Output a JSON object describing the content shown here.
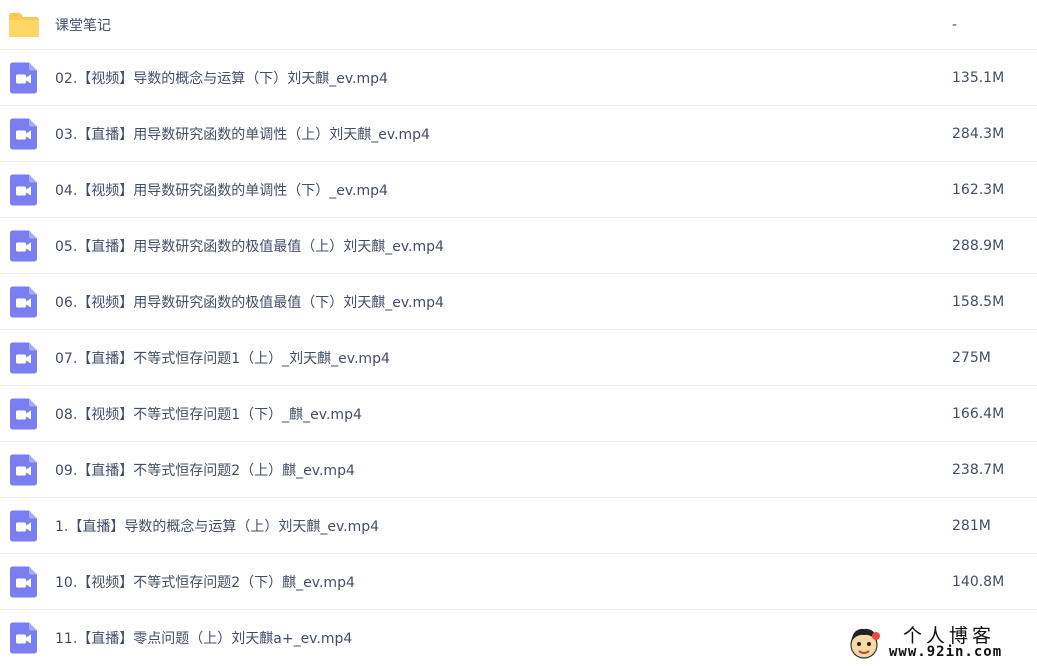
{
  "files": [
    {
      "name": "课堂笔记",
      "size": "-",
      "type": "folder",
      "icon": "folder-icon"
    },
    {
      "name": "02.【视频】导数的概念与运算（下）刘天麒_ev.mp4",
      "size": "135.1M",
      "type": "video",
      "icon": "video-file-icon"
    },
    {
      "name": "03.【直播】用导数研究函数的单调性（上）刘天麒_ev.mp4",
      "size": "284.3M",
      "type": "video",
      "icon": "video-file-icon"
    },
    {
      "name": "04.【视频】用导数研究函数的单调性（下）_ev.mp4",
      "size": "162.3M",
      "type": "video",
      "icon": "video-file-icon"
    },
    {
      "name": "05.【直播】用导数研究函数的极值最值（上）刘天麒_ev.mp4",
      "size": "288.9M",
      "type": "video",
      "icon": "video-file-icon"
    },
    {
      "name": "06.【视频】用导数研究函数的极值最值（下）刘天麒_ev.mp4",
      "size": "158.5M",
      "type": "video",
      "icon": "video-file-icon"
    },
    {
      "name": "07.【直播】不等式恒存问题1（上）_刘天麒_ev.mp4",
      "size": "275M",
      "type": "video",
      "icon": "video-file-icon"
    },
    {
      "name": "08.【视频】不等式恒存问题1（下）_麒_ev.mp4",
      "size": "166.4M",
      "type": "video",
      "icon": "video-file-icon"
    },
    {
      "name": "09.【直播】不等式恒存问题2（上）麒_ev.mp4",
      "size": "238.7M",
      "type": "video",
      "icon": "video-file-icon"
    },
    {
      "name": "1.【直播】导数的概念与运算（上）刘天麒_ev.mp4",
      "size": "281M",
      "type": "video",
      "icon": "video-file-icon"
    },
    {
      "name": "10.【视频】不等式恒存问题2（下）麒_ev.mp4",
      "size": "140.8M",
      "type": "video",
      "icon": "video-file-icon"
    },
    {
      "name": "11.【直播】零点问题（上）刘天麒a+_ev.mp4",
      "size": "",
      "type": "video",
      "icon": "video-file-icon"
    }
  ],
  "watermark": {
    "title": "个人博客",
    "url": "www.92in.com",
    "icon": "cartoon-face-icon"
  },
  "colors": {
    "folder": "#ffc94d",
    "video": "#7b7ef0",
    "text": "#424e67",
    "divider": "#f1f2f4"
  }
}
